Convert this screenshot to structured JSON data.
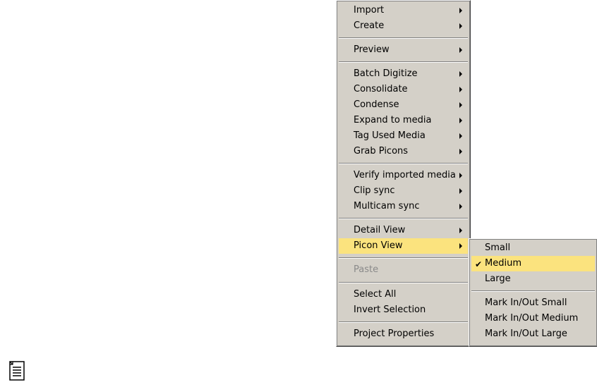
{
  "main_menu": {
    "import": "Import",
    "create": "Create",
    "preview": "Preview",
    "batch_digitize": "Batch Digitize",
    "consolidate": "Consolidate",
    "condense": "Condense",
    "expand_to_media": "Expand to media",
    "tag_used_media": "Tag Used Media",
    "grab_picons": "Grab Picons",
    "verify_imported_media": "Verify imported media",
    "clip_sync": "Clip sync",
    "multicam_sync": "Multicam sync",
    "detail_view": "Detail View",
    "picon_view": "Picon View",
    "paste": "Paste",
    "select_all": "Select All",
    "invert_selection": "Invert Selection",
    "project_properties": "Project Properties"
  },
  "picon_submenu": {
    "small": "Small",
    "medium": "Medium",
    "large": "Large",
    "mark_small": "Mark In/Out Small",
    "mark_medium": "Mark In/Out Medium",
    "mark_large": "Mark In/Out Large",
    "checked_item": "Medium"
  },
  "colors": {
    "menu_bg": "#d4d0c8",
    "highlight": "#fbe37e",
    "disabled_text": "#8a8a8a"
  },
  "icons": {
    "note": "note-icon",
    "check": "checkmark-icon",
    "submenu_arrow": "submenu-arrow-icon"
  }
}
